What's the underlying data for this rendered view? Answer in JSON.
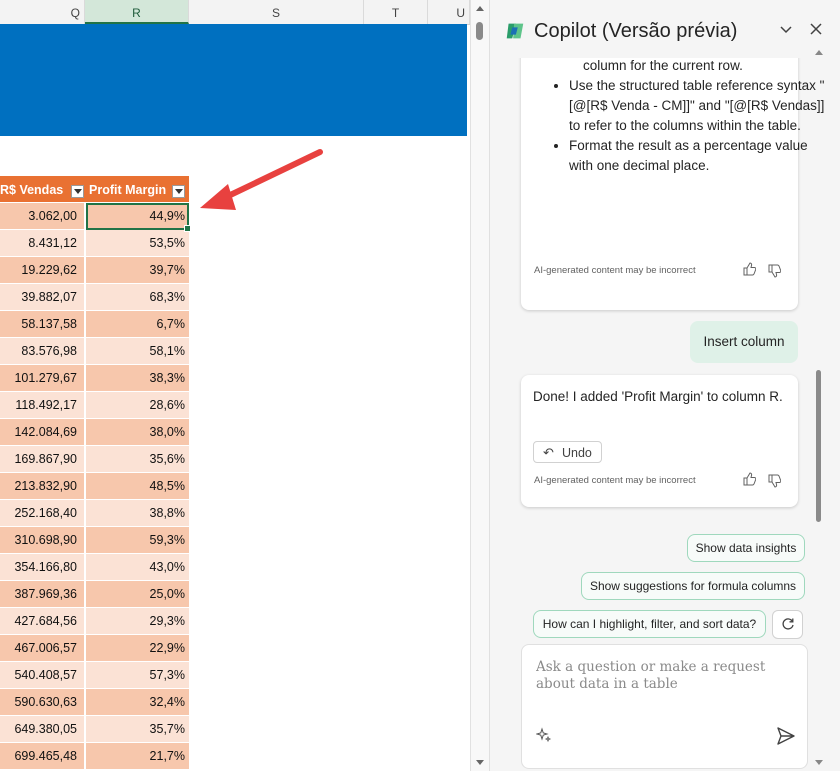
{
  "sheet": {
    "columns": [
      "Q",
      "R",
      "S",
      "T",
      "U"
    ],
    "table_headers": [
      "R$ Vendas",
      "Profit Margin"
    ],
    "rows": [
      [
        "3.062,00",
        "44,9%"
      ],
      [
        "8.431,12",
        "53,5%"
      ],
      [
        "19.229,62",
        "39,7%"
      ],
      [
        "39.882,07",
        "68,3%"
      ],
      [
        "58.137,58",
        "6,7%"
      ],
      [
        "83.576,98",
        "58,1%"
      ],
      [
        "101.279,67",
        "38,3%"
      ],
      [
        "118.492,17",
        "28,6%"
      ],
      [
        "142.084,69",
        "38,0%"
      ],
      [
        "169.867,90",
        "35,6%"
      ],
      [
        "213.832,90",
        "48,5%"
      ],
      [
        "252.168,40",
        "38,8%"
      ],
      [
        "310.698,90",
        "59,3%"
      ],
      [
        "354.166,80",
        "43,0%"
      ],
      [
        "387.969,36",
        "25,0%"
      ],
      [
        "427.684,56",
        "29,3%"
      ],
      [
        "467.006,57",
        "22,9%"
      ],
      [
        "540.408,57",
        "57,3%"
      ],
      [
        "590.630,63",
        "32,4%"
      ],
      [
        "649.380,05",
        "35,7%"
      ],
      [
        "699.465,48",
        "21,7%"
      ]
    ],
    "colors": {
      "banner": "#0070c0",
      "header": "#e97132",
      "band_odd": "#f7c7ac",
      "band_even": "#fbe2d5",
      "annotation_arrow": "#e8413f"
    }
  },
  "copilot": {
    "title": "Copilot (Versão prévia)",
    "header_icons": [
      "chevron-down-icon",
      "close-icon"
    ],
    "prev_message": {
      "continued_text": "column for the current row.",
      "bullets": [
        "Use the structured table reference syntax \"[@[R$ Venda - CM]]\" and \"[@[R$ Vendas]]\" to refer to the columns within the table.",
        "Format the result as a percentage value with one decimal place."
      ],
      "disclaimer": "AI-generated content may be incorrect"
    },
    "user_message": "Insert column",
    "reply": {
      "text": "Done! I added 'Profit Margin' to column R.",
      "undo_label": "Undo",
      "disclaimer": "AI-generated content may be incorrect"
    },
    "suggestions": [
      "Show data insights",
      "Show suggestions for formula columns",
      "How can I highlight, filter, and sort data?"
    ],
    "input_placeholder": "Ask a question or make a request about data in a table"
  }
}
